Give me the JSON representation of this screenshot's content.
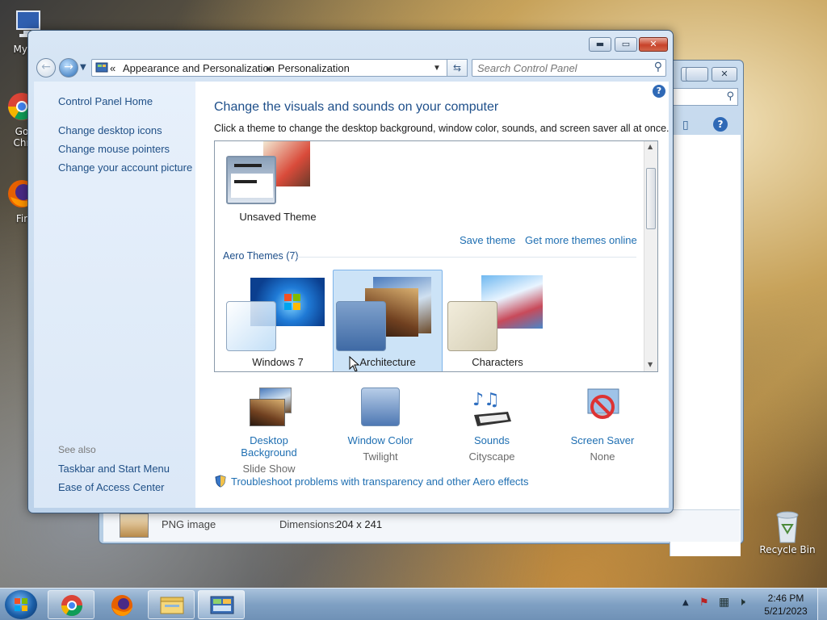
{
  "desktop": {
    "icons": [
      {
        "name": "My Co",
        "icon": "computer-icon"
      },
      {
        "name": "Go\nChr",
        "icon": "chrome-icon"
      },
      {
        "name": "Fir",
        "icon": "firefox-icon"
      },
      {
        "name": "Recycle Bin",
        "icon": "recycle-bin-icon"
      }
    ]
  },
  "background_window": {
    "file_type": "PNG image",
    "dimensions_label": "Dimensions:",
    "dimensions_value": "204 x 241"
  },
  "window": {
    "address": {
      "prefix": "«",
      "crumbs": [
        "Appearance and Personalization",
        "Personalization"
      ]
    },
    "search_placeholder": "Search Control Panel",
    "left_pane": {
      "home": "Control Panel Home",
      "links": [
        "Change desktop icons",
        "Change mouse pointers",
        "Change your account picture"
      ],
      "see_also_title": "See also",
      "see_also": [
        "Taskbar and Start Menu",
        "Ease of Access Center"
      ]
    },
    "content": {
      "heading": "Change the visuals and sounds on your computer",
      "subheading": "Click a theme to change the desktop background, window color, sounds, and screen saver all at once.",
      "unsaved_theme": "Unsaved Theme",
      "save_theme": "Save theme",
      "get_more": "Get more themes online",
      "aero_header": "Aero Themes (7)",
      "themes": [
        "Windows 7",
        "Architecture",
        "Characters"
      ],
      "selected_theme": "Architecture",
      "settings": [
        {
          "name": "Desktop Background",
          "value": "Slide Show"
        },
        {
          "name": "Window Color",
          "value": "Twilight"
        },
        {
          "name": "Sounds",
          "value": "Cityscape"
        },
        {
          "name": "Screen Saver",
          "value": "None"
        }
      ],
      "troubleshoot": "Troubleshoot problems with transparency and other Aero effects"
    }
  },
  "taskbar": {
    "time": "2:46 PM",
    "date": "5/21/2023"
  },
  "colors": {
    "link_blue": "#1f6fb2",
    "heading_blue": "#1e4f8a",
    "taskbar": "#7fa0c3"
  }
}
